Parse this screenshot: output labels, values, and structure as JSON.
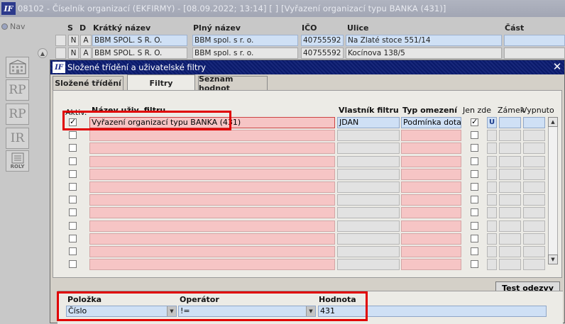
{
  "window": {
    "logo": "IF",
    "title": "08102 - Číselník organizací (EKFIRMY) - [08.09.2022; 13:14]  [ ]  [Vyřazení organizací typu BANKA (431)]"
  },
  "nav": {
    "label": "Nav"
  },
  "side_buttons": [
    {
      "label": "",
      "icon": "building-icon"
    },
    {
      "label": "RP",
      "icon": "report-icon"
    },
    {
      "label": "RP",
      "icon": "report-icon"
    },
    {
      "label": "IR",
      "icon": "report-icon"
    },
    {
      "label": "ROLY",
      "icon": "roles-icon"
    }
  ],
  "bg_grid": {
    "headers": {
      "s": "S",
      "d": "D",
      "short_name": "Krátký název",
      "full_name": "Plný název",
      "ico": "IČO",
      "street": "Ulice",
      "part": "Část"
    },
    "rows": [
      {
        "d": "N",
        "a": "A",
        "short_name": "BBM SPOL. S R. O.",
        "full_name": "BBM spol. s r. o.",
        "ico": "40755592",
        "street": "Na Zlaté stoce 551/14"
      },
      {
        "d": "N",
        "a": "A",
        "short_name": "BBM SPOL. S R. O.",
        "full_name": "BBM spol. s r. o.",
        "ico": "40755592",
        "street": "Kocínova 138/5"
      }
    ]
  },
  "dialog": {
    "logo": "IF",
    "title": "Složené třídění a uživatelské filtry",
    "tabs": [
      {
        "label": "Složené třídění"
      },
      {
        "label": "Filtry"
      },
      {
        "label": "Seznam hodnot"
      }
    ],
    "columns": {
      "active": "Aktiv.",
      "name": "Název uživ. filtru",
      "owner": "Vlastník filtru",
      "type": "Typ omezení",
      "only_here": "Jen zde",
      "lock": "Zámek",
      "off": "Vypnuto"
    },
    "first_row": {
      "name": "Vyřazení organizací typu BANKA (431)",
      "owner": "JDAN",
      "type": "Podmínka dotazu",
      "lock": "U"
    },
    "test_button": "Test odezvy",
    "condition": {
      "headers": {
        "item": "Položka",
        "operator": "Operátor",
        "value": "Hodnota"
      },
      "item": "Číslo",
      "operator": "!=",
      "value": "431"
    }
  },
  "colors": {
    "highlight_red": "#e00000",
    "pink_field": "#f6c5c5",
    "blue_field": "#cfe0f5",
    "dialog_title": "#0a1a6a"
  }
}
